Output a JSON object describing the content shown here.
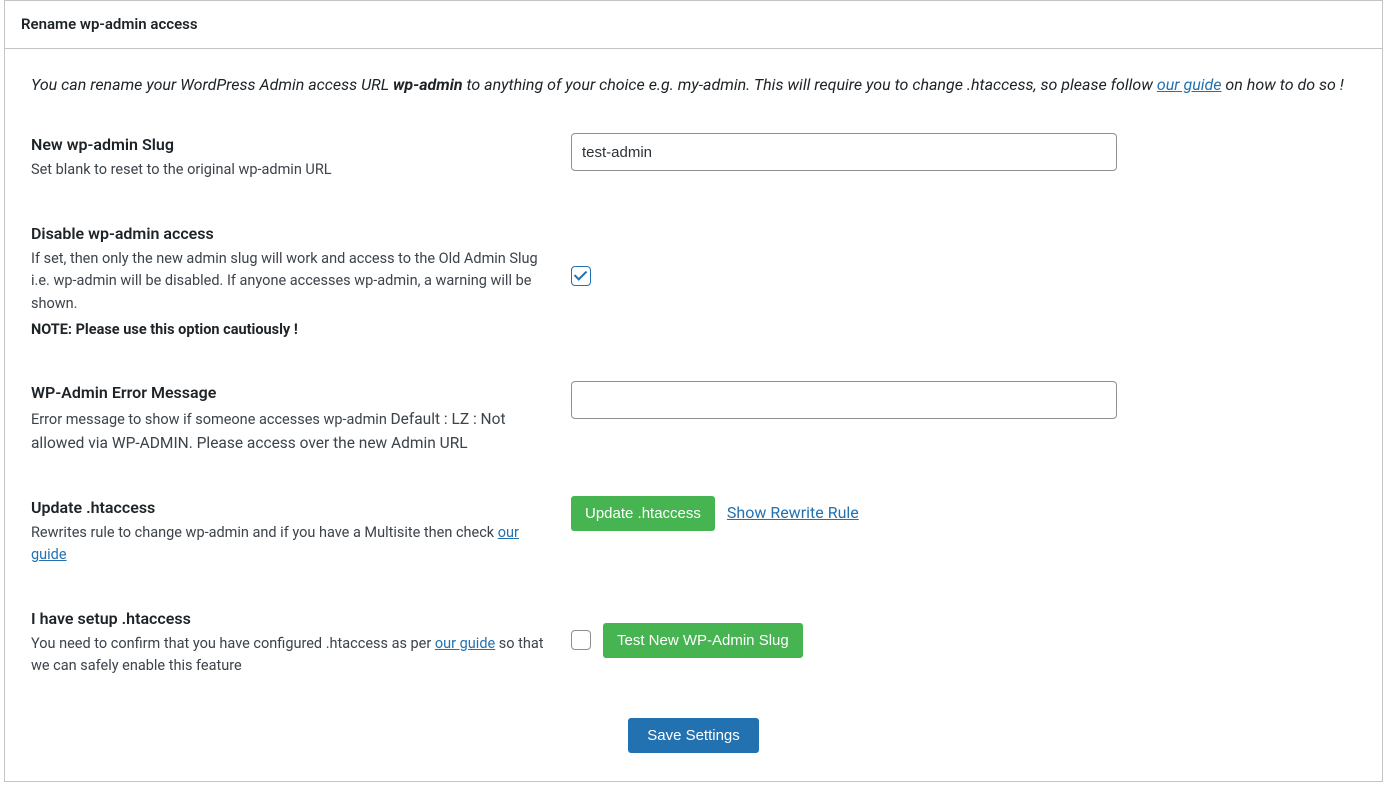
{
  "panel_title": "Rename wp-admin access",
  "intro": {
    "prefix": "You can rename your WordPress Admin access URL ",
    "bold": "wp-admin",
    "mid": " to anything of your choice e.g. my-admin. This will require you to change .htaccess, so please follow ",
    "link": "our guide",
    "suffix": " on how to do so !"
  },
  "rows": {
    "slug": {
      "label": "New wp-admin Slug",
      "desc": "Set blank to reset to the original wp-admin URL",
      "value": "test-admin"
    },
    "disable": {
      "label": "Disable wp-admin access",
      "desc": "If set, then only the new admin slug will work and access to the Old Admin Slug i.e. wp-admin will be disabled. If anyone accesses wp-admin, a warning will be shown.",
      "note": "NOTE: Please use this option cautiously !",
      "checked": true
    },
    "errmsg": {
      "label": "WP-Admin Error Message",
      "desc_prefix": "Error message to show if someone accesses wp-admin ",
      "desc_big": "Default : LZ : Not allowed via WP-ADMIN. Please access over the new Admin URL",
      "value": ""
    },
    "htaccess": {
      "label": "Update .htaccess",
      "desc_prefix": "Rewrites rule to change wp-admin and if you have a Multisite then check ",
      "desc_link": "our guide",
      "btn": "Update .htaccess",
      "showlink": "Show Rewrite Rule"
    },
    "confirm": {
      "label": "I have setup .htaccess",
      "desc_prefix": "You need to confirm that you have configured .htaccess as per ",
      "desc_link": "our guide",
      "desc_suffix": " so that we can safely enable this feature",
      "checked": false,
      "btn": "Test New WP-Admin Slug"
    }
  },
  "save_label": "Save Settings"
}
